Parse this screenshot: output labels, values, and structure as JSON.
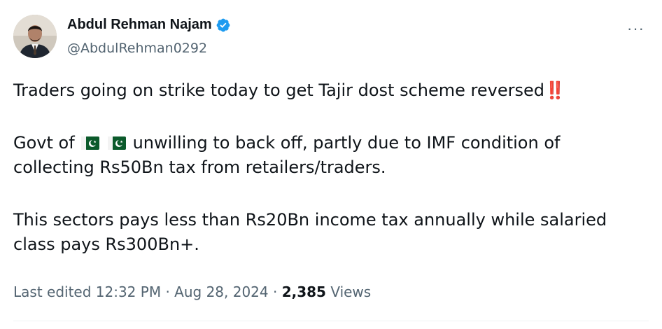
{
  "author": {
    "name": "Abdul Rehman Najam",
    "handle": "@AbdulRehman0292",
    "verified": true,
    "verified_color": "#1d9bf0"
  },
  "tweet": {
    "line1": "Traders going on strike today to get Tajir dost scheme reversed",
    "line1_emoji": "‼️",
    "p2_before_flags": "Govt of",
    "p2_after_flags": "unwilling to back off, partly due to IMF condition of",
    "p2_line2": "collecting Rs50Bn tax from retailers/traders.",
    "p3_line1": "This sectors pays less than Rs20Bn income tax annually while salaried",
    "p3_line2": "class pays Rs300Bn+.",
    "flags": [
      "pakistan-flag",
      "pakistan-flag"
    ]
  },
  "meta": {
    "edited_label": "Last edited 12:32 PM · Aug 28, 2024 ·",
    "views_count": "2,385",
    "views_label": "Views"
  },
  "more_label": "···",
  "icons": {
    "more": "more-horizontal-icon",
    "verified": "verified-badge-icon"
  }
}
